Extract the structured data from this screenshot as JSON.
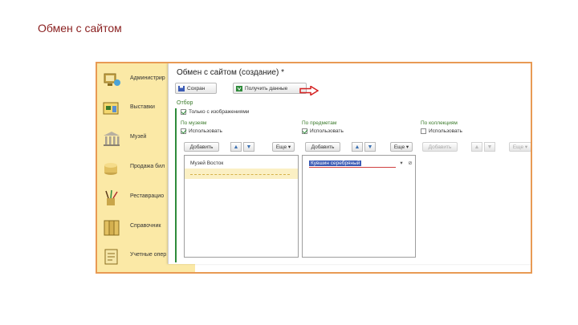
{
  "slide": {
    "title": "Обмен с сайтом"
  },
  "sidebar": {
    "items": [
      {
        "label": "Администрир",
        "icon": "computer-icon"
      },
      {
        "label": "Выставки",
        "icon": "exhibition-board-icon"
      },
      {
        "label": "Музей",
        "icon": "museum-columns-icon"
      },
      {
        "label": "Продажа бил",
        "icon": "coins-icon"
      },
      {
        "label": "Реставрацио",
        "icon": "tools-icon"
      },
      {
        "label": "Справочник",
        "icon": "folders-icon"
      },
      {
        "label": "Учетные опер",
        "icon": "document-icon"
      }
    ]
  },
  "window": {
    "title": "Обмен с сайтом (создание) *",
    "toolbar": {
      "save_label": "Сохран",
      "fetch_label": "Получить данные"
    },
    "filter_title": "Отбор",
    "only_with_images": {
      "label": "Только с изображениями",
      "checked": true
    },
    "columns": [
      {
        "heading": "По музеям",
        "use_label": "Использовать",
        "use_checked": true,
        "add_label": "Добавить",
        "more_label": "Еще",
        "enabled": true,
        "rows": [
          "Музей Восток",
          ""
        ]
      },
      {
        "heading": "По предметам",
        "use_label": "Использовать",
        "use_checked": true,
        "add_label": "Добавить",
        "more_label": "Еще",
        "enabled": true,
        "editing_value": "Кувшин серебряный"
      },
      {
        "heading": "По коллекциям",
        "use_label": "Использовать",
        "use_checked": false,
        "add_label": "Добавить",
        "more_label": "Еще",
        "enabled": false
      }
    ]
  },
  "colors": {
    "frame_border": "#e89a54",
    "sidebar_bg": "#fbe9a6",
    "accent_green": "#2e8b3a",
    "title_red": "#8a1f1f",
    "selection_blue": "#3b5bb5"
  }
}
